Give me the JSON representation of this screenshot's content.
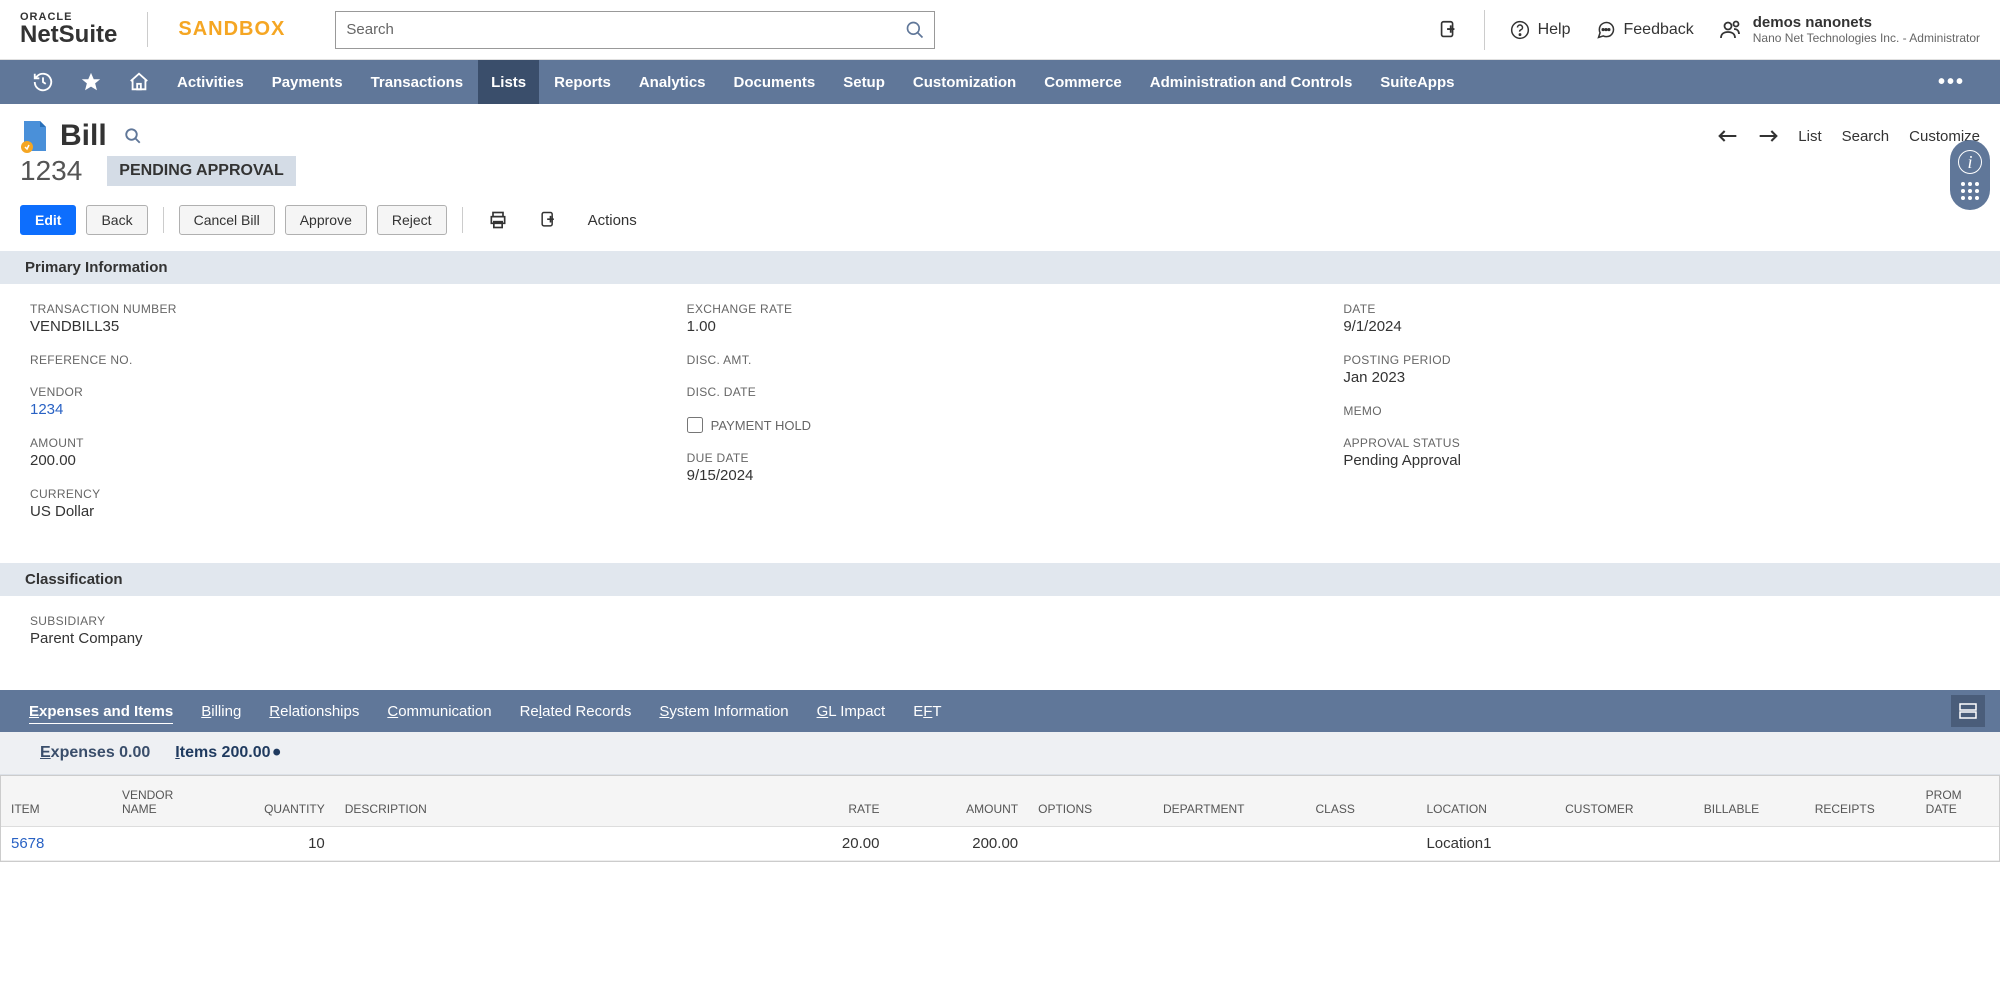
{
  "header": {
    "oracle": "ORACLE",
    "netsuite": "NetSuite",
    "sandbox": "SANDBOX",
    "search_placeholder": "Search",
    "help": "Help",
    "feedback": "Feedback",
    "user_name": "demos nanonets",
    "user_company": "Nano Net Technologies Inc. - Administrator"
  },
  "nav": {
    "items": [
      "Activities",
      "Payments",
      "Transactions",
      "Lists",
      "Reports",
      "Analytics",
      "Documents",
      "Setup",
      "Customization",
      "Commerce",
      "Administration and Controls",
      "SuiteApps"
    ],
    "active_index": 3
  },
  "page": {
    "title": "Bill",
    "record_number": "1234",
    "status": "PENDING APPROVAL",
    "actions": {
      "list": "List",
      "search": "Search",
      "customize": "Customize"
    },
    "buttons": {
      "edit": "Edit",
      "back": "Back",
      "cancel": "Cancel Bill",
      "approve": "Approve",
      "reject": "Reject",
      "actions": "Actions"
    }
  },
  "sections": {
    "primary": {
      "title": "Primary Information",
      "col1": {
        "transaction_number": {
          "label": "TRANSACTION NUMBER",
          "value": "VENDBILL35"
        },
        "reference_no": {
          "label": "REFERENCE NO.",
          "value": ""
        },
        "vendor": {
          "label": "VENDOR",
          "value": "1234"
        },
        "amount": {
          "label": "AMOUNT",
          "value": "200.00"
        },
        "currency": {
          "label": "CURRENCY",
          "value": "US Dollar"
        }
      },
      "col2": {
        "exchange_rate": {
          "label": "EXCHANGE RATE",
          "value": "1.00"
        },
        "disc_amt": {
          "label": "DISC. AMT.",
          "value": ""
        },
        "disc_date": {
          "label": "DISC. DATE",
          "value": ""
        },
        "payment_hold": {
          "label": "PAYMENT HOLD",
          "checked": false
        },
        "due_date": {
          "label": "DUE DATE",
          "value": "9/15/2024"
        }
      },
      "col3": {
        "date": {
          "label": "DATE",
          "value": "9/1/2024"
        },
        "posting_period": {
          "label": "POSTING PERIOD",
          "value": "Jan 2023"
        },
        "memo": {
          "label": "MEMO",
          "value": ""
        },
        "approval_status": {
          "label": "APPROVAL STATUS",
          "value": "Pending Approval"
        }
      }
    },
    "classification": {
      "title": "Classification",
      "subsidiary": {
        "label": "SUBSIDIARY",
        "value": "Parent Company"
      }
    }
  },
  "tabs": [
    "Expenses and Items",
    "Billing",
    "Relationships",
    "Communication",
    "Related Records",
    "System Information",
    "GL Impact",
    "EFT"
  ],
  "subtabs": {
    "expenses": "Expenses 0.00",
    "items": "Items 200.00"
  },
  "table": {
    "headers": [
      "ITEM",
      "VENDOR NAME",
      "QUANTITY",
      "DESCRIPTION",
      "RATE",
      "AMOUNT",
      "OPTIONS",
      "DEPARTMENT",
      "CLASS",
      "LOCATION",
      "CUSTOMER",
      "BILLABLE",
      "RECEIPTS",
      "PROM DATE"
    ],
    "row": {
      "item": "5678",
      "vendor_name": "",
      "quantity": "10",
      "description": "",
      "rate": "20.00",
      "amount": "200.00",
      "options": "",
      "department": "",
      "class": "",
      "location": "Location1",
      "customer": "",
      "billable": "",
      "receipts": "",
      "prom_date": ""
    }
  }
}
